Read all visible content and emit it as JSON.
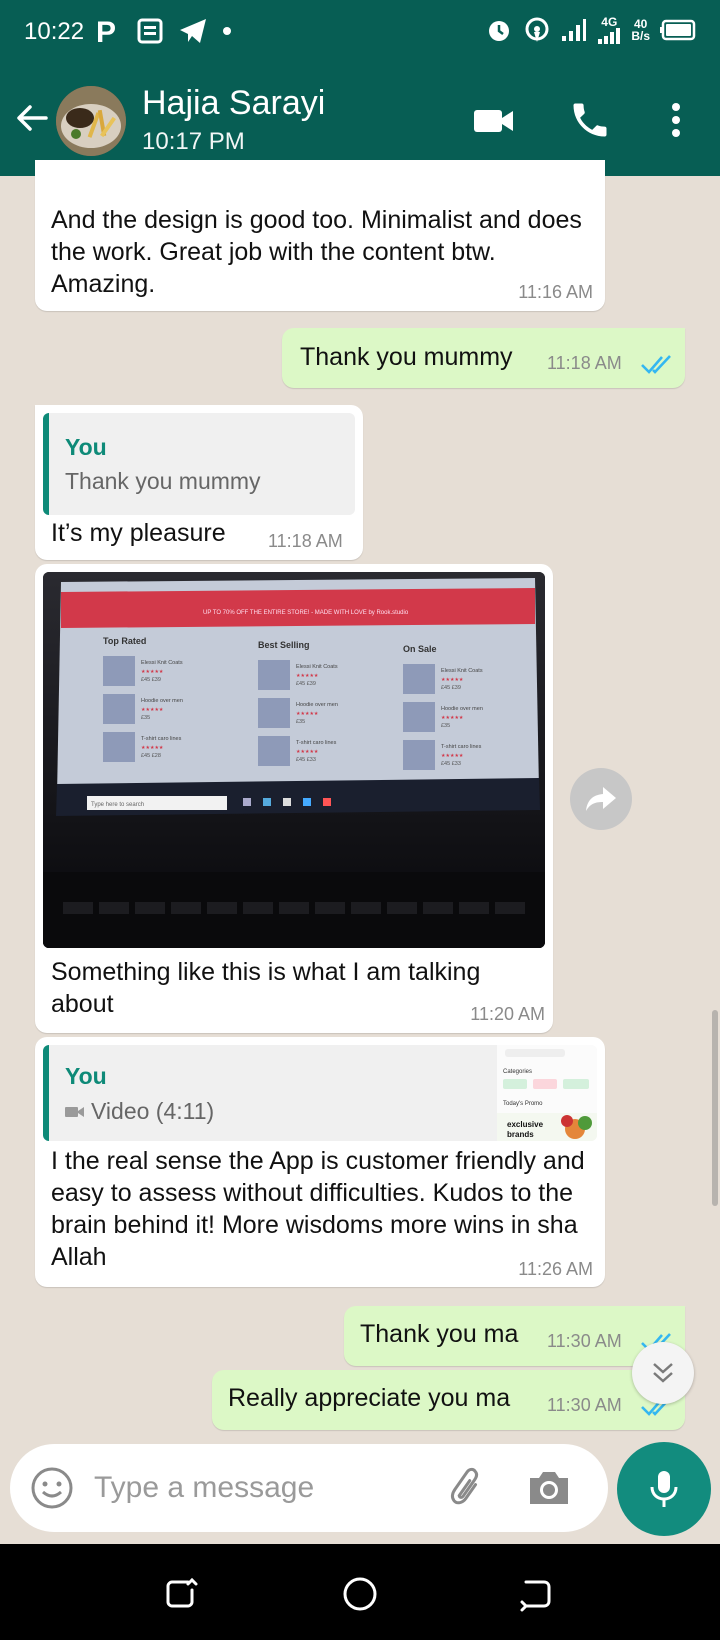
{
  "status_bar": {
    "time": "10:22",
    "speed_value": "40",
    "speed_unit": "B/s",
    "network": "4G"
  },
  "header": {
    "name": "Hajia Sarayi",
    "subtitle": "10:17 PM"
  },
  "messages": [
    {
      "id": "m1",
      "direction": "incoming",
      "text": "And the design is good too. Minimalist and does the work. Great job with the content btw. Amazing.",
      "time": "11:16 AM"
    },
    {
      "id": "m2",
      "direction": "outgoing",
      "text": "Thank you mummy",
      "time": "11:18 AM",
      "status": "read"
    },
    {
      "id": "m3",
      "direction": "incoming",
      "quote": {
        "author": "You",
        "text": "Thank you mummy"
      },
      "text": "It’s my pleasure",
      "time": "11:18 AM"
    },
    {
      "id": "m4",
      "direction": "incoming",
      "type": "image",
      "image": {
        "banner": "UP TO 70% OFF THE ENTIRE STORE! - MADE WITH LOVE by Rook.studio",
        "columns": [
          {
            "title": "Top Rated",
            "items": [
              {
                "name": "Elessi Knit Coats",
                "old": "£45",
                "price": "£39"
              },
              {
                "name": "Hoodie over men",
                "old": "",
                "price": "£35"
              },
              {
                "name": "T-shirt caro lines",
                "old": "£45",
                "price": "£28"
              }
            ]
          },
          {
            "title": "Best Selling",
            "items": [
              {
                "name": "Elessi Knit Coats",
                "old": "£45",
                "price": "£39"
              },
              {
                "name": "Hoodie over men",
                "old": "",
                "price": "£35"
              },
              {
                "name": "T-shirt caro lines",
                "old": "£45",
                "price": "£33"
              }
            ]
          },
          {
            "title": "On Sale",
            "items": [
              {
                "name": "Elessi Knit Coats",
                "old": "£45",
                "price": "£39"
              },
              {
                "name": "Hoodie over men",
                "old": "",
                "price": "£35"
              },
              {
                "name": "T-shirt caro lines",
                "old": "£45",
                "price": "£33"
              }
            ]
          }
        ],
        "taskbar_search": "Type here to search"
      },
      "text": "Something like this is what I am talking about",
      "time": "11:20 AM"
    },
    {
      "id": "m5",
      "direction": "incoming",
      "quote": {
        "author": "You",
        "text": "Video (4:11)",
        "thumb": {
          "l1": "Categories",
          "l2": "Today's Promo",
          "l3": "exclusive",
          "l4": "brands"
        }
      },
      "text": "I the real sense the App is customer friendly and easy to assess without difficulties. Kudos to the brain behind it! More wisdoms more wins in sha Allah",
      "time": "11:26 AM"
    },
    {
      "id": "m6",
      "direction": "outgoing",
      "text": "Thank you ma",
      "time": "11:30 AM",
      "status": "read"
    },
    {
      "id": "m7",
      "direction": "outgoing",
      "text": "Really appreciate you ma",
      "time": "11:30 AM",
      "status": "read"
    }
  ],
  "composer": {
    "placeholder": "Type a message"
  },
  "colors": {
    "header": "#075e54",
    "accent": "#128c7e",
    "outgoing": "#dcf8c6",
    "incoming": "#ffffff",
    "wallpaper": "#e6ded5",
    "tick_read": "#34b7f1"
  },
  "icons": [
    "back-arrow-icon",
    "video-call-icon",
    "phone-icon",
    "more-vert-icon",
    "emoji-icon",
    "attach-icon",
    "camera-icon",
    "mic-icon",
    "share-icon",
    "chevron-double-down-icon",
    "nav-recents-icon",
    "nav-home-icon",
    "nav-back-icon"
  ]
}
